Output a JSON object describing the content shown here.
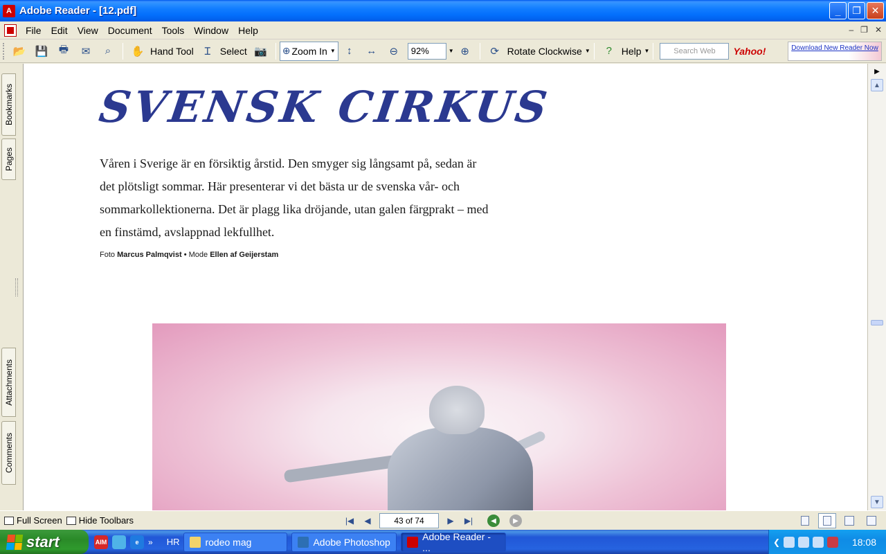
{
  "window": {
    "title": "Adobe Reader - [12.pdf]",
    "minimize": "_",
    "maximize": "❐",
    "close": "✕"
  },
  "menu": [
    "File",
    "Edit",
    "View",
    "Document",
    "Tools",
    "Window",
    "Help"
  ],
  "toolbar": {
    "hand_tool": "Hand Tool",
    "select": "Select",
    "zoom_in": "Zoom In",
    "zoom_value": "92%",
    "rotate": "Rotate Clockwise",
    "help": "Help",
    "search_placeholder": "Search Web",
    "yahoo": "Yahoo!",
    "download": "Download New Reader Now"
  },
  "side_tabs": {
    "bookmarks": "Bookmarks",
    "pages": "Pages",
    "attachments": "Attachments",
    "comments": "Comments"
  },
  "document": {
    "headline": "SVENSK CIRKUS",
    "intro_lines": [
      "Våren i Sverige är en försiktig årstid. Den smyger sig långsamt på, sedan är",
      "det plötsligt sommar. Här presenterar vi det bästa ur de svenska vår- och",
      "sommarkollektionerna. Det är plagg lika dröjande, utan galen färgprakt – med",
      "en finstämd, avslappnad lekfullhet."
    ],
    "credit": {
      "foto_label": "Foto",
      "photographer": "Marcus Palmqvist",
      "sep": "•",
      "mode_label": "Mode",
      "stylist": "Ellen af Geijerstam"
    }
  },
  "statusbar": {
    "full_screen": "Full Screen",
    "hide_toolbars": "Hide Toolbars",
    "page_indicator": "43 of 74"
  },
  "taskbar": {
    "start": "start",
    "lang": "HR",
    "tasks": [
      {
        "label": "rodeo mag",
        "active": false
      },
      {
        "label": "Adobe Photoshop",
        "active": false
      },
      {
        "label": "Adobe Reader - ...",
        "active": true
      }
    ],
    "clock": "18:08",
    "quicklaunch_aim": "AIM"
  },
  "colors": {
    "headline": "#2b3990",
    "taskbar": "#245edc",
    "start_green": "#2f9a2d"
  }
}
